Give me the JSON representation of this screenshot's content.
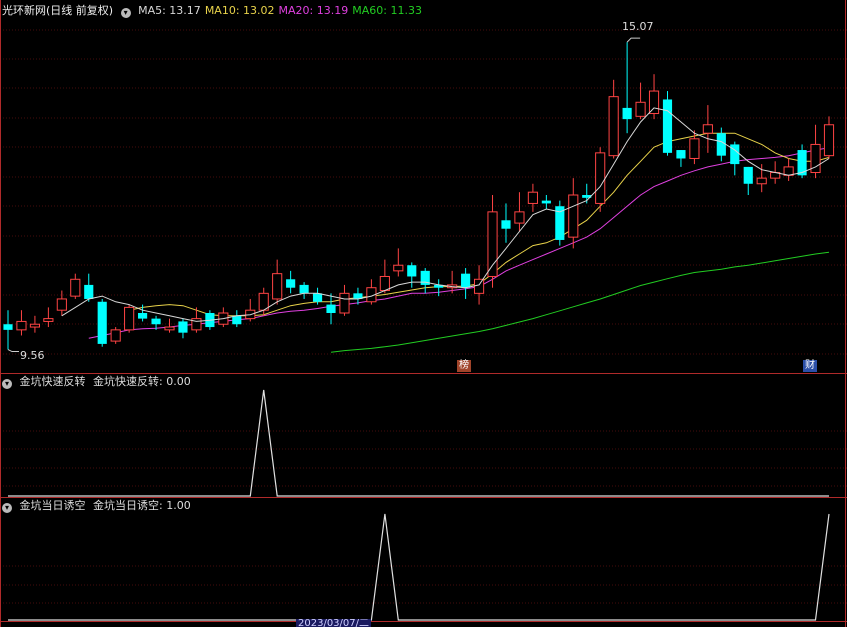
{
  "main": {
    "title": "光环新网(日线 前复权)",
    "ma_legend": [
      {
        "label": "MA5: 13.17",
        "color": "#d8d8d8"
      },
      {
        "label": "MA10: 13.02",
        "color": "#e8d24a"
      },
      {
        "label": "MA20: 13.19",
        "color": "#e040e0"
      },
      {
        "label": "MA60: 11.33",
        "color": "#22cc22"
      }
    ],
    "high_label": "15.07",
    "low_label": "9.56",
    "badge_left": "榜",
    "badge_right": "财"
  },
  "sub1": {
    "title": "金坑快速反转",
    "value_label": "金坑快速反转: 0.00"
  },
  "sub2": {
    "title": "金坑当日诱空",
    "value_label": "金坑当日诱空: 1.00"
  },
  "date_label": "2023/03/07/二",
  "colors": {
    "up": "#ff4444",
    "down": "#00ffff",
    "grid": "#8b1a1a",
    "ma5": "#d8d8d8",
    "ma10": "#e8d24a",
    "ma20": "#e040e0",
    "ma60": "#22cc22",
    "indicator": "#e0e0e0"
  },
  "chart_data": [
    {
      "type": "candlestick",
      "ylim": [
        9.2,
        15.5
      ],
      "candles": [
        [
          10.05,
          9.95,
          10.3,
          9.6
        ],
        [
          9.95,
          10.1,
          10.3,
          9.85
        ],
        [
          10.0,
          10.05,
          10.2,
          9.9
        ],
        [
          10.1,
          10.15,
          10.35,
          10.0
        ],
        [
          10.3,
          10.5,
          10.65,
          10.2
        ],
        [
          10.55,
          10.85,
          10.95,
          10.5
        ],
        [
          10.75,
          10.5,
          10.95,
          10.45
        ],
        [
          10.45,
          9.7,
          10.5,
          9.65
        ],
        [
          9.75,
          9.95,
          10.0,
          9.7
        ],
        [
          9.95,
          10.35,
          10.4,
          9.9
        ],
        [
          10.25,
          10.15,
          10.4,
          10.1
        ],
        [
          10.15,
          10.05,
          10.2,
          9.95
        ],
        [
          9.95,
          10.0,
          10.15,
          9.9
        ],
        [
          10.1,
          9.9,
          10.15,
          9.8
        ],
        [
          9.95,
          10.15,
          10.35,
          9.9
        ],
        [
          10.25,
          10.0,
          10.3,
          9.95
        ],
        [
          10.05,
          10.25,
          10.35,
          10.0
        ],
        [
          10.2,
          10.05,
          10.3,
          10.0
        ],
        [
          10.15,
          10.3,
          10.5,
          10.1
        ],
        [
          10.3,
          10.6,
          10.7,
          10.2
        ],
        [
          10.5,
          10.95,
          11.2,
          10.4
        ],
        [
          10.85,
          10.7,
          11.0,
          10.6
        ],
        [
          10.75,
          10.6,
          10.8,
          10.5
        ],
        [
          10.6,
          10.45,
          10.7,
          10.4
        ],
        [
          10.4,
          10.25,
          10.6,
          10.05
        ],
        [
          10.25,
          10.6,
          10.75,
          10.2
        ],
        [
          10.6,
          10.5,
          10.7,
          10.4
        ],
        [
          10.45,
          10.7,
          10.85,
          10.4
        ],
        [
          10.65,
          10.9,
          11.2,
          10.6
        ],
        [
          11.0,
          11.1,
          11.4,
          10.9
        ],
        [
          11.1,
          10.9,
          11.15,
          10.7
        ],
        [
          11.0,
          10.75,
          11.05,
          10.6
        ],
        [
          10.75,
          10.7,
          10.85,
          10.55
        ],
        [
          10.7,
          10.75,
          11.0,
          10.6
        ],
        [
          10.95,
          10.7,
          11.05,
          10.5
        ],
        [
          10.6,
          10.85,
          11.1,
          10.4
        ],
        [
          10.9,
          12.05,
          12.35,
          10.7
        ],
        [
          11.9,
          11.75,
          12.2,
          11.5
        ],
        [
          11.85,
          12.05,
          12.4,
          11.7
        ],
        [
          12.2,
          12.4,
          12.55,
          12.05
        ],
        [
          12.25,
          12.2,
          12.35,
          12.1
        ],
        [
          12.15,
          11.55,
          12.25,
          11.45
        ],
        [
          11.6,
          12.35,
          12.65,
          11.4
        ],
        [
          12.35,
          12.3,
          12.55,
          12.2
        ],
        [
          12.2,
          13.1,
          13.2,
          12.05
        ],
        [
          13.05,
          14.1,
          14.4,
          13.0
        ],
        [
          13.9,
          13.7,
          15.07,
          13.45
        ],
        [
          13.75,
          14.0,
          14.35,
          13.7
        ],
        [
          13.8,
          14.2,
          14.5,
          13.7
        ],
        [
          14.05,
          13.1,
          14.2,
          13.05
        ],
        [
          13.15,
          13.0,
          13.15,
          12.85
        ],
        [
          13.0,
          13.35,
          13.5,
          12.9
        ],
        [
          13.45,
          13.6,
          13.95,
          13.1
        ],
        [
          13.45,
          13.05,
          13.55,
          12.95
        ],
        [
          13.25,
          12.9,
          13.3,
          12.7
        ],
        [
          12.85,
          12.55,
          12.85,
          12.35
        ],
        [
          12.55,
          12.65,
          12.9,
          12.4
        ],
        [
          12.65,
          12.75,
          12.95,
          12.55
        ],
        [
          12.7,
          12.85,
          13.0,
          12.6
        ],
        [
          13.15,
          12.7,
          13.25,
          12.65
        ],
        [
          12.75,
          13.25,
          13.6,
          12.65
        ],
        [
          13.05,
          13.6,
          13.75,
          13.0
        ]
      ],
      "ma5": [
        null,
        null,
        null,
        null,
        10.2,
        10.35,
        10.5,
        10.55,
        10.45,
        10.4,
        10.3,
        10.25,
        10.2,
        10.15,
        10.1,
        10.12,
        10.15,
        10.2,
        10.22,
        10.3,
        10.45,
        10.55,
        10.6,
        10.6,
        10.55,
        10.5,
        10.5,
        10.55,
        10.65,
        10.75,
        10.8,
        10.8,
        10.75,
        10.72,
        10.7,
        10.75,
        11.1,
        11.4,
        11.7,
        12.0,
        12.1,
        12.05,
        12.15,
        12.25,
        12.5,
        12.9,
        13.3,
        13.65,
        13.9,
        13.85,
        13.65,
        13.45,
        13.35,
        13.3,
        13.15,
        12.95,
        12.8,
        12.75,
        12.7,
        12.75,
        12.85,
        13.0
      ],
      "ma10": [
        null,
        null,
        null,
        null,
        null,
        null,
        null,
        null,
        null,
        10.3,
        10.35,
        10.38,
        10.4,
        10.38,
        10.3,
        10.22,
        10.2,
        10.2,
        10.2,
        10.22,
        10.3,
        10.38,
        10.42,
        10.45,
        10.45,
        10.5,
        10.52,
        10.55,
        10.58,
        10.62,
        10.66,
        10.7,
        10.72,
        10.72,
        10.73,
        10.77,
        10.95,
        11.15,
        11.3,
        11.45,
        11.5,
        11.6,
        11.75,
        11.9,
        12.15,
        12.4,
        12.7,
        12.95,
        13.2,
        13.3,
        13.35,
        13.4,
        13.45,
        13.45,
        13.45,
        13.35,
        13.25,
        13.1,
        13.0,
        12.95,
        12.95,
        13.02
      ],
      "ma20": [
        null,
        null,
        null,
        null,
        null,
        null,
        9.8,
        9.85,
        9.9,
        9.95,
        9.97,
        9.98,
        10.0,
        10.03,
        10.05,
        10.08,
        10.1,
        10.13,
        10.15,
        10.2,
        10.25,
        10.28,
        10.3,
        10.33,
        10.37,
        10.4,
        10.43,
        10.47,
        10.5,
        10.55,
        10.6,
        10.6,
        10.62,
        10.65,
        10.68,
        10.72,
        10.85,
        11.0,
        11.1,
        11.2,
        11.3,
        11.4,
        11.5,
        11.6,
        11.75,
        11.95,
        12.15,
        12.35,
        12.5,
        12.6,
        12.7,
        12.78,
        12.85,
        12.9,
        12.95,
        12.98,
        13.0,
        13.02,
        13.05,
        13.1,
        13.15,
        13.19
      ],
      "ma60": [
        null,
        null,
        null,
        null,
        null,
        null,
        null,
        null,
        null,
        null,
        null,
        null,
        null,
        null,
        null,
        null,
        null,
        null,
        null,
        null,
        null,
        null,
        null,
        null,
        9.55,
        9.58,
        9.6,
        9.62,
        9.65,
        9.68,
        9.72,
        9.76,
        9.8,
        9.84,
        9.88,
        9.92,
        9.97,
        10.03,
        10.09,
        10.15,
        10.22,
        10.29,
        10.36,
        10.43,
        10.5,
        10.58,
        10.66,
        10.74,
        10.8,
        10.86,
        10.92,
        10.97,
        11.0,
        11.03,
        11.07,
        11.1,
        11.14,
        11.18,
        11.22,
        11.26,
        11.3,
        11.33
      ]
    },
    {
      "type": "line",
      "series": [
        {
          "values": [
            0,
            0,
            0,
            0,
            0,
            0,
            0,
            0,
            0,
            0,
            0,
            0,
            0,
            0,
            0,
            0,
            0,
            0,
            0,
            1,
            0,
            0,
            0,
            0,
            0,
            0,
            0,
            0,
            0,
            0,
            0,
            0,
            0,
            0,
            0,
            0,
            0,
            0,
            0,
            0,
            0,
            0,
            0,
            0,
            0,
            0,
            0,
            0,
            0,
            0,
            0,
            0,
            0,
            0,
            0,
            0,
            0,
            0,
            0,
            0,
            0,
            0
          ]
        }
      ],
      "ylim": [
        0,
        1
      ]
    },
    {
      "type": "line",
      "series": [
        {
          "values": [
            0,
            0,
            0,
            0,
            0,
            0,
            0,
            0,
            0,
            0,
            0,
            0,
            0,
            0,
            0,
            0,
            0,
            0,
            0,
            0,
            0,
            0,
            0,
            0,
            0,
            0,
            0,
            0,
            1,
            0,
            0,
            0,
            0,
            0,
            0,
            0,
            0,
            0,
            0,
            0,
            0,
            0,
            0,
            0,
            0,
            0,
            0,
            0,
            0,
            0,
            0,
            0,
            0,
            0,
            0,
            0,
            0,
            0,
            0,
            0,
            0,
            1
          ]
        }
      ],
      "ylim": [
        0,
        1
      ]
    }
  ]
}
